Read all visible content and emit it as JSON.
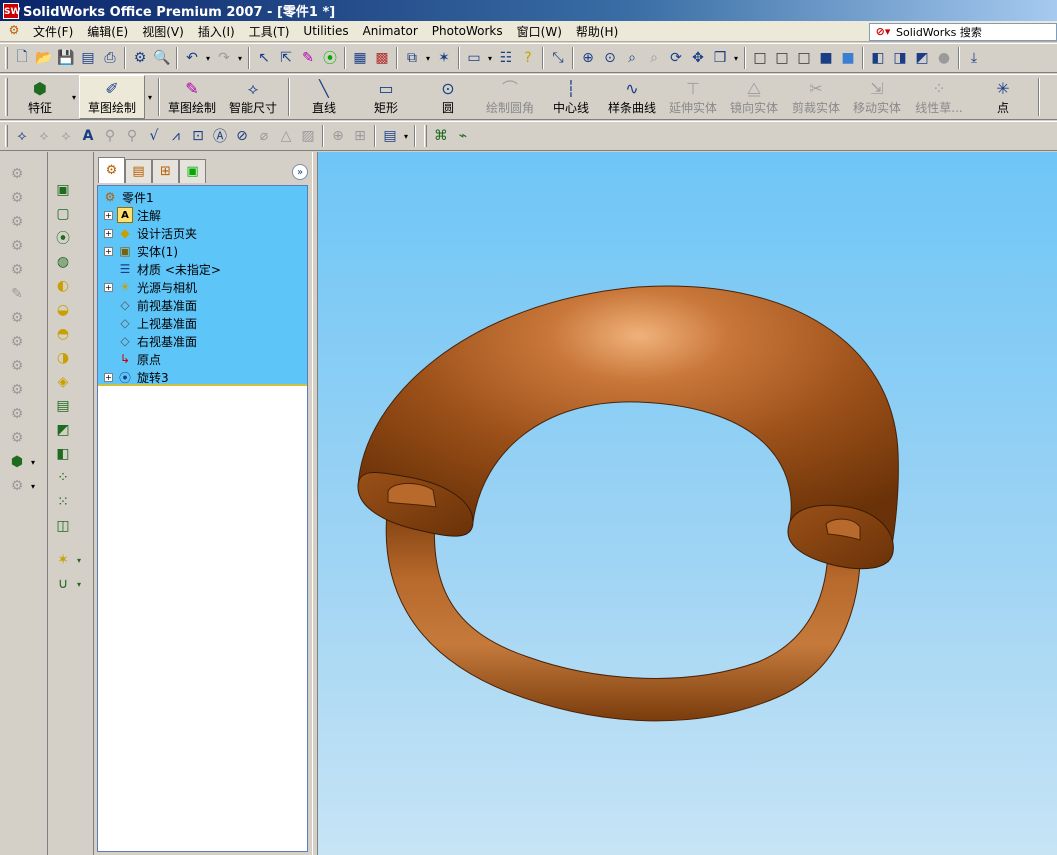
{
  "window": {
    "title": "SolidWorks Office Premium 2007 - [零件1 *]",
    "logo_text": "SW"
  },
  "menu": {
    "items": [
      "文件(F)",
      "编辑(E)",
      "视图(V)",
      "插入(I)",
      "工具(T)",
      "Utilities",
      "Animator",
      "PhotoWorks",
      "窗口(W)",
      "帮助(H)"
    ]
  },
  "search": {
    "label": "SolidWorks 搜索",
    "icon": "search-icon"
  },
  "command_manager": {
    "features_label": "特征",
    "sketch_label": "草图绘制",
    "buttons": [
      {
        "label": "草图绘制",
        "icon": "sketch-icon",
        "enabled": true
      },
      {
        "label": "智能尺寸",
        "icon": "dimension-icon",
        "enabled": true
      },
      {
        "label": "直线",
        "icon": "line-icon",
        "enabled": true
      },
      {
        "label": "矩形",
        "icon": "rectangle-icon",
        "enabled": true
      },
      {
        "label": "圆",
        "icon": "circle-icon",
        "enabled": true
      },
      {
        "label": "绘制圆角",
        "icon": "fillet-icon",
        "enabled": false
      },
      {
        "label": "中心线",
        "icon": "centerline-icon",
        "enabled": true
      },
      {
        "label": "样条曲线",
        "icon": "spline-icon",
        "enabled": true
      },
      {
        "label": "延伸实体",
        "icon": "extend-icon",
        "enabled": false
      },
      {
        "label": "镜向实体",
        "icon": "mirror-icon",
        "enabled": false
      },
      {
        "label": "剪裁实体",
        "icon": "trim-icon",
        "enabled": false
      },
      {
        "label": "移动实体",
        "icon": "move-icon",
        "enabled": false
      },
      {
        "label": "线性草...",
        "icon": "linear-pattern-icon",
        "enabled": false
      },
      {
        "label": "点",
        "icon": "point-icon",
        "enabled": true
      }
    ]
  },
  "feature_tree": {
    "root": "零件1",
    "nodes": [
      {
        "label": "注解",
        "expandable": true,
        "icon": "annotation-icon"
      },
      {
        "label": "设计活页夹",
        "expandable": true,
        "icon": "design-binder-icon"
      },
      {
        "label": "实体(1)",
        "expandable": true,
        "icon": "solid-body-icon"
      },
      {
        "label": "材质 <未指定>",
        "expandable": false,
        "icon": "material-icon"
      },
      {
        "label": "光源与相机",
        "expandable": true,
        "icon": "lights-icon"
      },
      {
        "label": "前视基准面",
        "expandable": false,
        "icon": "plane-icon"
      },
      {
        "label": "上视基准面",
        "expandable": false,
        "icon": "plane-icon"
      },
      {
        "label": "右视基准面",
        "expandable": false,
        "icon": "plane-icon"
      },
      {
        "label": "原点",
        "expandable": false,
        "icon": "origin-icon"
      },
      {
        "label": "旋转3",
        "expandable": true,
        "icon": "revolve-icon"
      }
    ]
  },
  "colors": {
    "viewport_top": "#6ec6f6",
    "viewport_bottom": "#c7e4f5",
    "model_base": "#a95a1c",
    "model_highlight": "#e8a46a",
    "model_shadow": "#5a2a08",
    "tree_selection": "#5ec5f9"
  }
}
